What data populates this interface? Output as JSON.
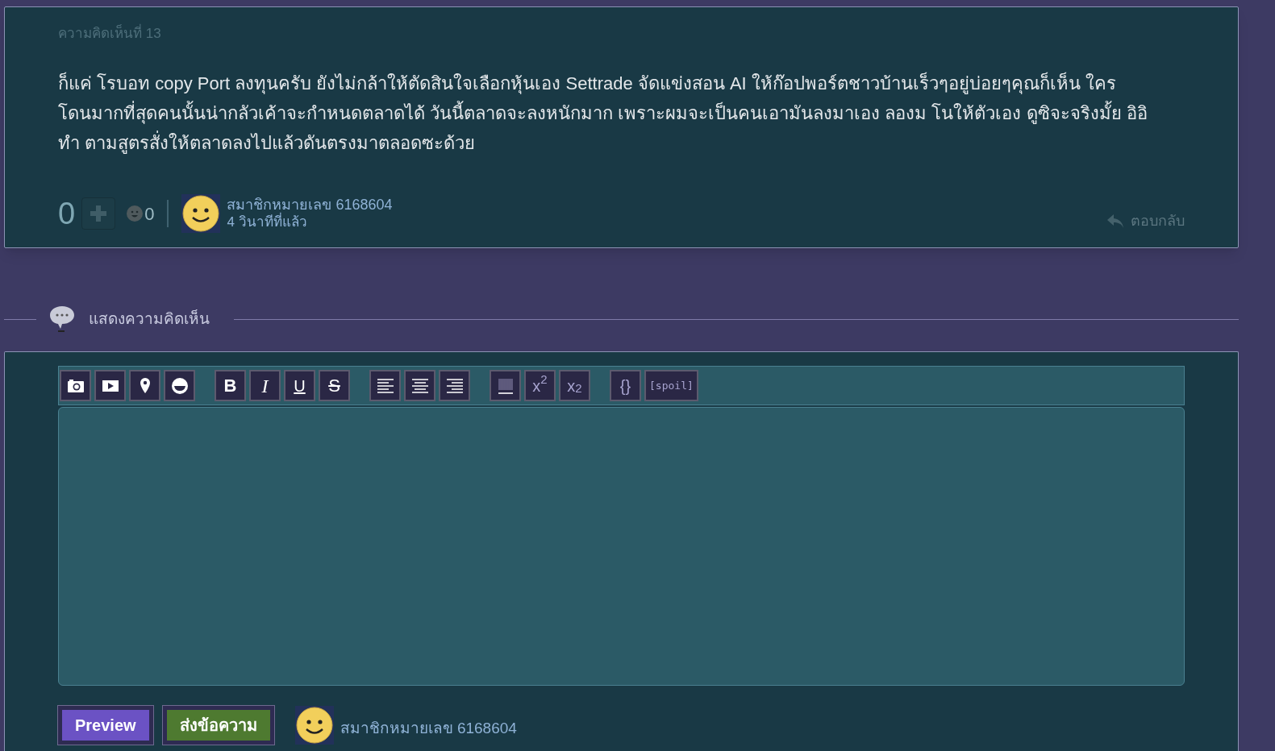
{
  "comment": {
    "number": "ความคิดเห็นที่ 13",
    "body": "ก็แค่ โรบอท copy Port ลงทุนครับ ยังไม่กล้าให้ตัดสินใจเลือกหุ้นเอง Settrade จัดแข่งสอน AI ให้ก๊อปพอร์ตชาวบ้านเร็วๆอยู่บ่อยๆคุณก็เห็น  ใคร โดนมากที่สุดคนนั้นน่ากลัวเค้าจะกำหนดตลาดได้ วันนี้ตลาดจะลงหนักมาก เพราะผมจะเป็นคนเอามันลงมาเอง ลองม โนให้ตัวเอง ดูซิจะจริงมั้ย อิอิ ทำ ตามสูตรสั่งให้ตลาดลงไปแล้วดันตรงมาตลอดซะด้วย",
    "score": "0",
    "reaction_count": "0",
    "author": "สมาชิกหมายเลข 6168604",
    "time": "4 วินาทีที่แล้ว",
    "reply": "ตอบกลับ"
  },
  "section_title": "แสดงความคิดเห็น",
  "toolbar": [
    [
      {
        "kind": "photo"
      },
      {
        "kind": "video"
      },
      {
        "kind": "location"
      },
      {
        "kind": "emoji"
      }
    ],
    [
      {
        "kind": "bold",
        "label": "B"
      },
      {
        "kind": "italic",
        "label": "I"
      },
      {
        "kind": "underline",
        "label": "U"
      },
      {
        "kind": "strike",
        "label": "S"
      }
    ],
    [
      {
        "kind": "align_left"
      },
      {
        "kind": "align_center"
      },
      {
        "kind": "align_right"
      }
    ],
    [
      {
        "kind": "rule"
      },
      {
        "kind": "superscript",
        "label": "x$^{2}$"
      },
      {
        "kind": "subscript",
        "label": "x$_{2}$"
      }
    ],
    [
      {
        "kind": "code",
        "label": "{}"
      },
      {
        "kind": "spoiler",
        "label": "[spoil]"
      }
    ]
  ],
  "buttons": [
    {
      "label": "Preview",
      "kind": "preview"
    },
    {
      "label": "ส่งข้อความ",
      "kind": "submit"
    }
  ],
  "composer_author": "สมาชิกหมายเลข 6168604"
}
